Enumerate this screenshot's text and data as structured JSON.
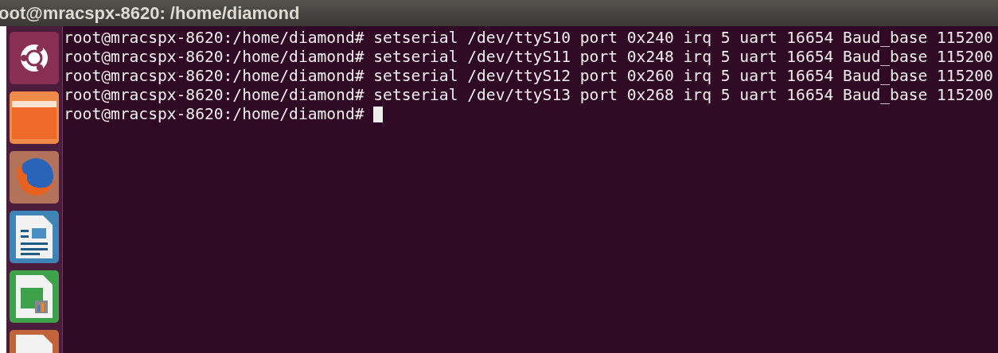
{
  "window": {
    "title": "oot@mracspx-8620: /home/diamond"
  },
  "launcher": {
    "items": [
      {
        "kind": "ubuntu"
      },
      {
        "kind": "folder"
      },
      {
        "kind": "firefox"
      },
      {
        "kind": "writer"
      },
      {
        "kind": "calc"
      },
      {
        "kind": "impress"
      }
    ]
  },
  "terminal": {
    "lines": [
      {
        "text": "root@mracspx-8620:/home/diamond# setserial /dev/ttyS10 port 0x240 irq 5 uart 16654 Baud_base 115200",
        "cursor": false
      },
      {
        "text": "root@mracspx-8620:/home/diamond# setserial /dev/ttyS11 port 0x248 irq 5 uart 16654 Baud_base 115200",
        "cursor": false
      },
      {
        "text": "root@mracspx-8620:/home/diamond# setserial /dev/ttyS12 port 0x260 irq 5 uart 16654 Baud_base 115200",
        "cursor": false
      },
      {
        "text": "root@mracspx-8620:/home/diamond# setserial /dev/ttyS13 port 0x268 irq 5 uart 16654 Baud_base 115200",
        "cursor": false
      },
      {
        "text": "root@mracspx-8620:/home/diamond#",
        "cursor": true
      }
    ]
  }
}
